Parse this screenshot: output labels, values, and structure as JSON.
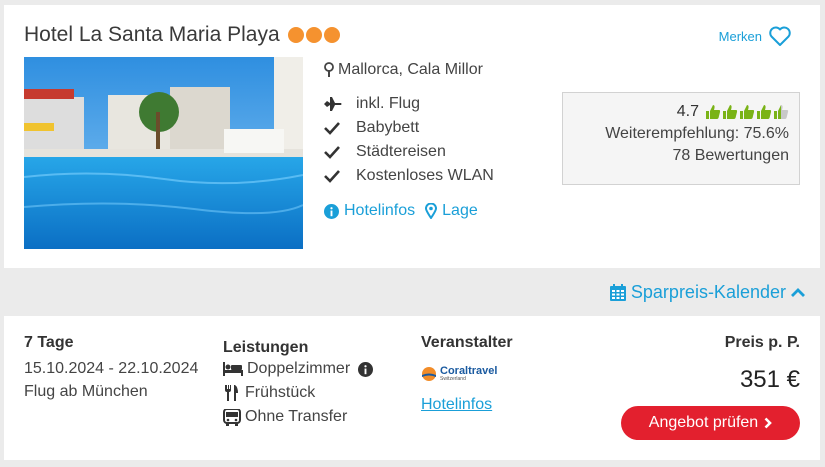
{
  "hotel": {
    "name": "Hotel La Santa Maria Playa",
    "stars": 3,
    "location": "Mallorca, Cala Millor",
    "features": [
      {
        "icon": "plane-icon",
        "label": "inkl. Flug"
      },
      {
        "icon": "check-icon",
        "label": "Babybett"
      },
      {
        "icon": "check-icon",
        "label": "Städtereisen"
      },
      {
        "icon": "check-icon",
        "label": "Kostenloses WLAN"
      }
    ],
    "links": {
      "info": "Hotelinfos",
      "location": "Lage"
    }
  },
  "merken": {
    "label": "Merken"
  },
  "rating": {
    "score": "4.7",
    "thumbs_filled": 4.5,
    "recommendation": "Weiterempfehlung: 75.6%",
    "reviews": "78 Bewertungen"
  },
  "calendar": {
    "label": "Sparpreis-Kalender"
  },
  "offer": {
    "duration": "7 Tage",
    "dates": "15.10.2024 - 22.10.2024",
    "departure": "Flug ab München",
    "services_title": "Leistungen",
    "services": [
      {
        "icon": "bed-icon",
        "label": "Doppelzimmer"
      },
      {
        "icon": "cutlery-icon",
        "label": "Frühstück"
      },
      {
        "icon": "bus-icon",
        "label": "Ohne Transfer"
      }
    ],
    "operator_title": "Veranstalter",
    "operator_brand": "Coraltravel",
    "operator_sub": "Switzerland",
    "operator_link": "Hotelinfos",
    "price_title": "Preis p. P.",
    "price": "351 €",
    "cta": "Angebot prüfen"
  },
  "colors": {
    "accent": "#1a9fd8",
    "star": "#f5922f",
    "thumb": "#7ab317",
    "cta": "#e3202e"
  }
}
